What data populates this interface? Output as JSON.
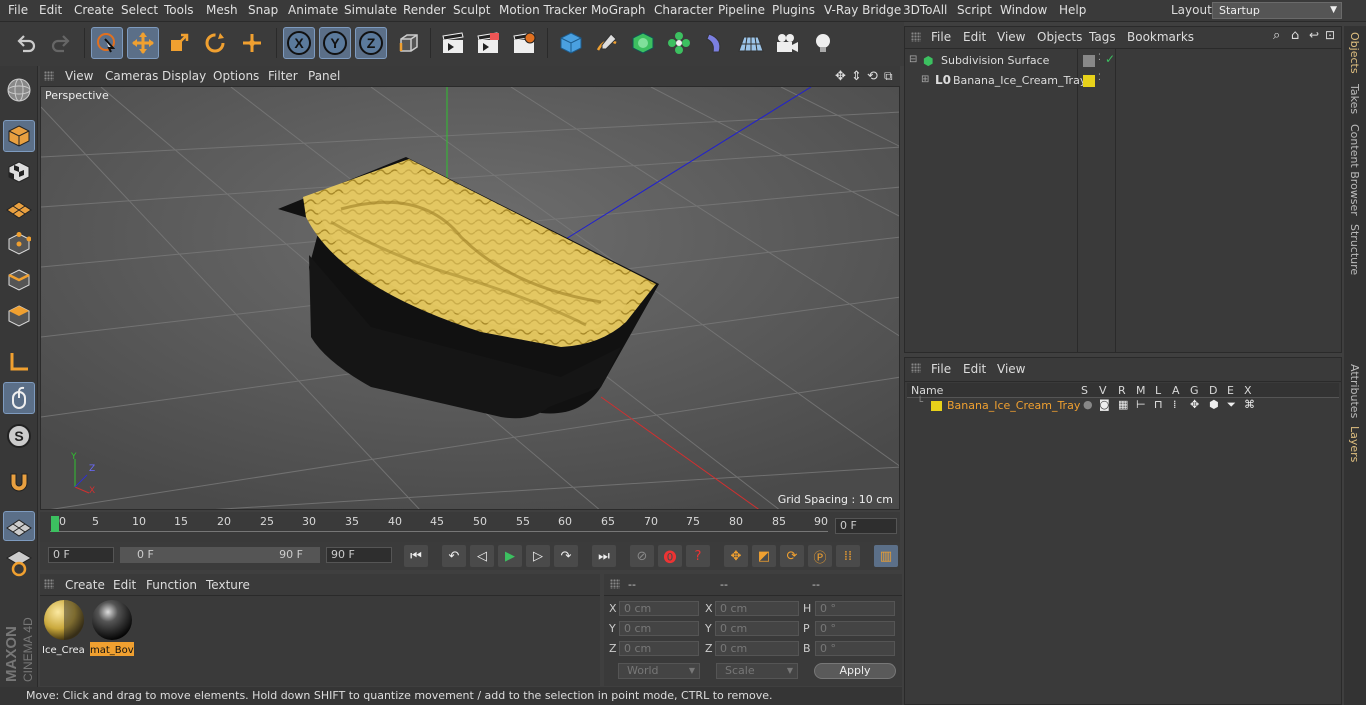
{
  "menu": [
    "File",
    "Edit",
    "Create",
    "Select",
    "Tools",
    "Mesh",
    "Snap",
    "Animate",
    "Simulate",
    "Render",
    "Sculpt",
    "Motion Tracker",
    "MoGraph",
    "Character",
    "Pipeline",
    "Plugins",
    "V-Ray Bridge",
    "3DToAll",
    "Script",
    "Window",
    "Help"
  ],
  "layout": {
    "label": "Layout:",
    "value": "Startup"
  },
  "viewport": {
    "menu": [
      "View",
      "Cameras",
      "Display",
      "Options",
      "Filter",
      "Panel"
    ],
    "camera_label": "Perspective",
    "grid_spacing": "Grid Spacing : 10 cm"
  },
  "timeline": {
    "ticks": [
      "0",
      "5",
      "10",
      "15",
      "20",
      "25",
      "30",
      "35",
      "40",
      "45",
      "50",
      "55",
      "60",
      "65",
      "70",
      "75",
      "80",
      "85",
      "90"
    ],
    "current_frame": "0 F"
  },
  "transport": {
    "start": "0 F",
    "range_start": "0 F",
    "range_end": "90 F",
    "end": "90 F"
  },
  "materials": {
    "menu": [
      "Create",
      "Edit",
      "Function",
      "Texture"
    ],
    "items": [
      {
        "label": "Ice_Crea"
      },
      {
        "label": "mat_Bov"
      }
    ]
  },
  "coords": {
    "headers": [
      "--",
      "--",
      "--"
    ],
    "rows": [
      {
        "a": "X",
        "av": "0 cm",
        "b": "X",
        "bv": "0 cm",
        "c": "H",
        "cv": "0 °"
      },
      {
        "a": "Y",
        "av": "0 cm",
        "b": "Y",
        "bv": "0 cm",
        "c": "P",
        "cv": "0 °"
      },
      {
        "a": "Z",
        "av": "0 cm",
        "b": "Z",
        "bv": "0 cm",
        "c": "B",
        "cv": "0 °"
      }
    ],
    "mode1": "World",
    "mode2": "Scale",
    "apply": "Apply"
  },
  "status": "Move: Click and drag to move elements. Hold down SHIFT to quantize movement / add to the selection in point mode, CTRL to remove.",
  "objects": {
    "menu": [
      "File",
      "Edit",
      "View",
      "Objects",
      "Tags",
      "Bookmarks"
    ],
    "items": [
      "Subdivision Surface",
      "Banana_Ice_Cream_Tray"
    ]
  },
  "layers": {
    "menu": [
      "File",
      "Edit",
      "View"
    ],
    "columns": [
      "Name",
      "S",
      "V",
      "R",
      "M",
      "L",
      "A",
      "G",
      "D",
      "E",
      "X"
    ],
    "items": [
      "Banana_Ice_Cream_Tray"
    ]
  },
  "right_tabs": [
    "Objects",
    "Takes",
    "Content Browser",
    "Structure",
    "Attributes",
    "Layers"
  ],
  "colors": {
    "accent": "#5b6f88",
    "layer_yellow": "#e8d21a",
    "ice_cream": "#e2c760",
    "tray": "#151515",
    "active_orange": "#f0a030"
  }
}
